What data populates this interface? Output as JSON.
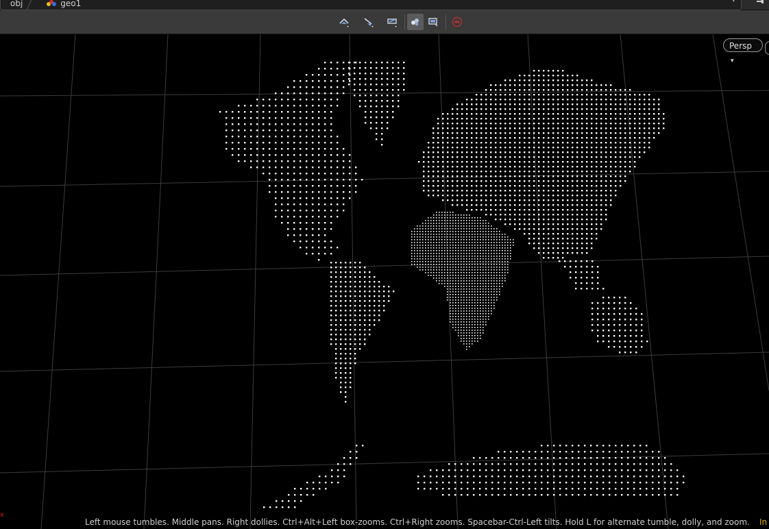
{
  "path": {
    "crumbs": [
      "obj",
      "geo1"
    ],
    "dropdown_icon": "chevron-down-icon",
    "pin_icon": "pin-icon"
  },
  "toolbar": {
    "buttons": [
      {
        "name": "view-tool-1-icon",
        "active": false
      },
      {
        "name": "view-tool-2-icon",
        "active": false
      },
      {
        "name": "view-tool-3-icon",
        "active": false
      },
      {
        "name": "display-options-icon",
        "active": true
      },
      {
        "name": "snapshot-icon",
        "active": false
      },
      {
        "name": "stop-icon",
        "active": false
      }
    ]
  },
  "viewport": {
    "camera_label": "Persp",
    "point_color": "#ffffff",
    "grid_color": "#3c3c3c"
  },
  "status": {
    "text": "Left mouse tumbles. Middle pans. Right dollies. Ctrl+Alt+Left box-zooms. Ctrl+Right zooms. Spacebar-Ctrl-Left tilts. Hold L for alternate tumble, dolly, and zoom.",
    "left_marker": "x",
    "right_text": "In"
  }
}
